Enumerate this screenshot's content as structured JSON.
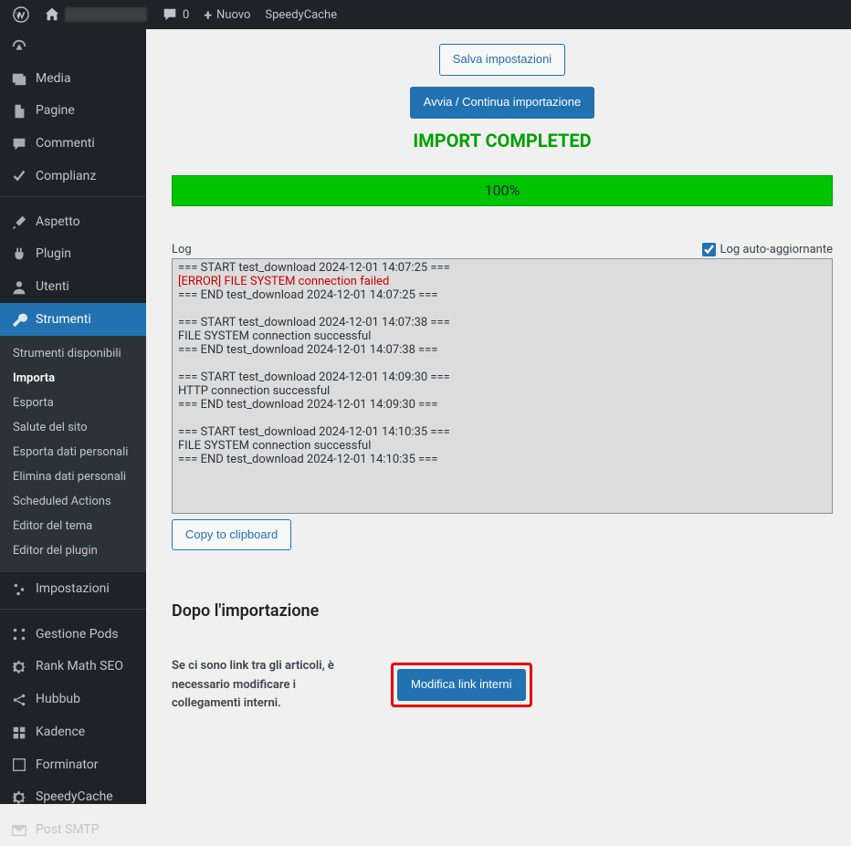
{
  "adminbar": {
    "comments_count": "0",
    "new_label": "Nuovo",
    "speedycache_label": "SpeedyCache"
  },
  "sidebar": {
    "items": [
      {
        "icon": "dashboard",
        "label": ""
      },
      {
        "icon": "media",
        "label": "Media"
      },
      {
        "icon": "page",
        "label": "Pagine"
      },
      {
        "icon": "comment",
        "label": "Commenti"
      },
      {
        "icon": "check",
        "label": "Complianz"
      },
      {
        "sep": true
      },
      {
        "icon": "brush",
        "label": "Aspetto"
      },
      {
        "icon": "plug",
        "label": "Plugin"
      },
      {
        "icon": "user",
        "label": "Utenti"
      },
      {
        "icon": "wrench",
        "label": "Strumenti",
        "current": true
      },
      {
        "icon": "sliders",
        "label": "Impostazioni"
      },
      {
        "sep": true
      },
      {
        "icon": "pods",
        "label": "Gestione Pods"
      },
      {
        "icon": "gear",
        "label": "Rank Math SEO"
      },
      {
        "icon": "share",
        "label": "Hubbub"
      },
      {
        "icon": "grid",
        "label": "Kadence"
      },
      {
        "icon": "form",
        "label": "Forminator"
      },
      {
        "icon": "gear",
        "label": "SpeedyCache"
      },
      {
        "icon": "mail",
        "label": "Post SMTP"
      }
    ],
    "submenu": [
      "Strumenti disponibili",
      "Importa",
      "Esporta",
      "Salute del sito",
      "Esporta dati personali",
      "Elimina dati personali",
      "Scheduled Actions",
      "Editor del tema",
      "Editor del plugin"
    ],
    "submenu_current_index": 1
  },
  "buttons": {
    "save_settings": "Salva impostazioni",
    "start_import": "Avvia / Continua importazione",
    "copy_clipboard": "Copy to clipboard",
    "fix_links": "Modifica link interni"
  },
  "status_text": "IMPORT COMPLETED",
  "progress_text": "100%",
  "log": {
    "heading": "Log",
    "auto_label": "Log auto-aggiornante",
    "auto_checked": true,
    "entries": [
      {
        "text": "=== START test_download 2024-12-01 14:07:25 ==="
      },
      {
        "text": "[ERROR] FILE SYSTEM connection failed",
        "error": true
      },
      {
        "text": "=== END test_download 2024-12-01 14:07:25 ==="
      },
      {
        "text": ""
      },
      {
        "text": "=== START test_download 2024-12-01 14:07:38 ==="
      },
      {
        "text": "FILE SYSTEM connection successful"
      },
      {
        "text": "=== END test_download 2024-12-01 14:07:38 ==="
      },
      {
        "text": ""
      },
      {
        "text": "=== START test_download 2024-12-01 14:09:30 ==="
      },
      {
        "text": "HTTP connection successful"
      },
      {
        "text": "=== END test_download 2024-12-01 14:09:30 ==="
      },
      {
        "text": ""
      },
      {
        "text": "=== START test_download 2024-12-01 14:10:35 ==="
      },
      {
        "text": "FILE SYSTEM connection successful"
      },
      {
        "text": "=== END test_download 2024-12-01 14:10:35 ==="
      }
    ]
  },
  "after": {
    "title": "Dopo l'importazione",
    "text": "Se ci sono link tra gli articoli, è necessario modificare i collegamenti interni."
  }
}
